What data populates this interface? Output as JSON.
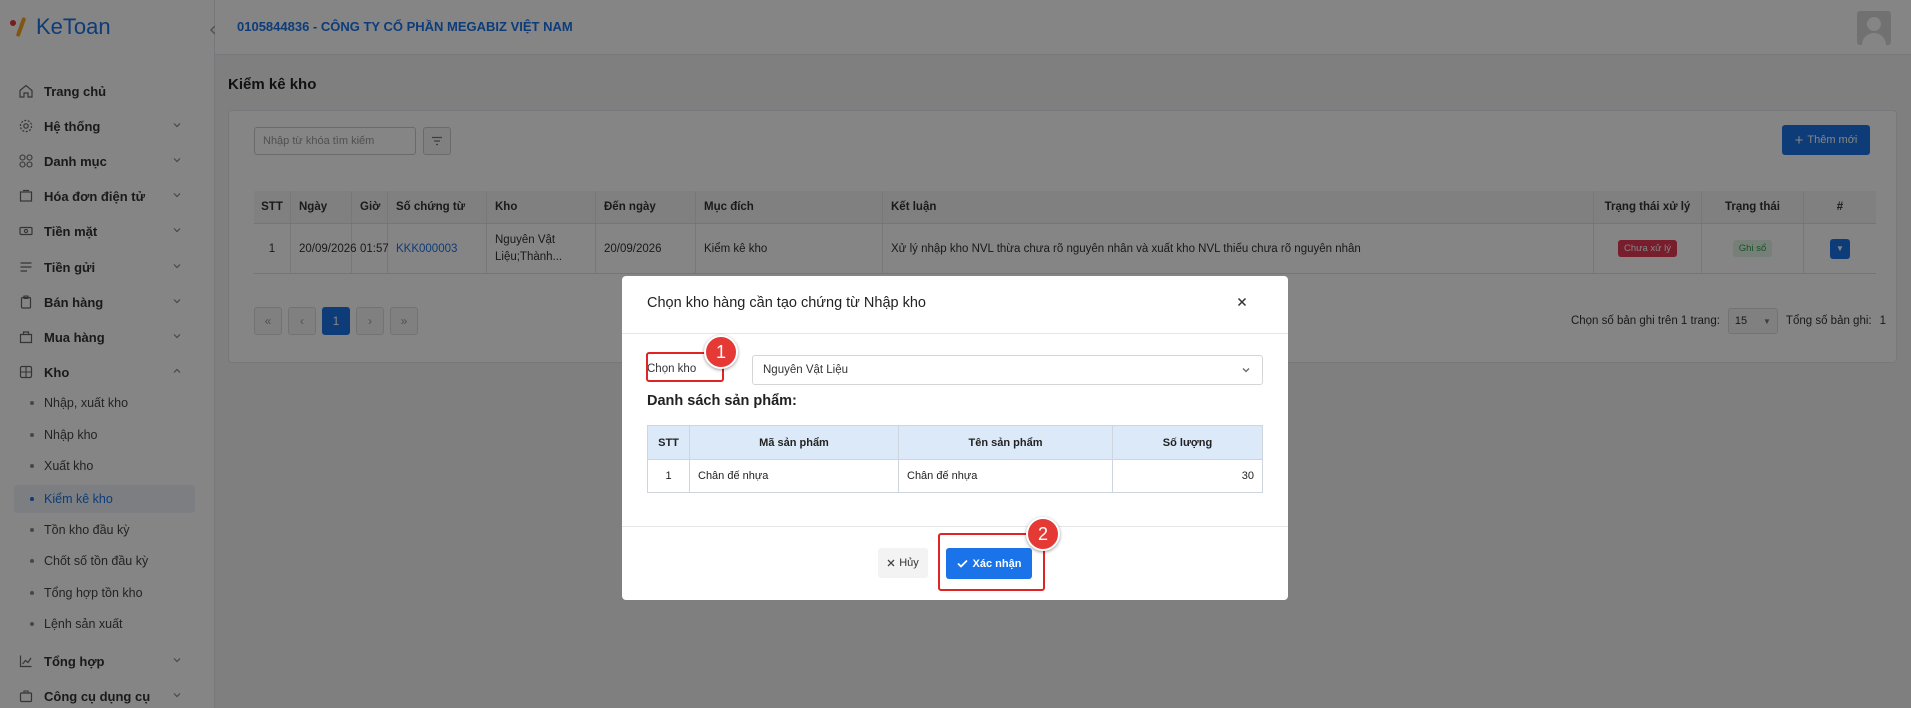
{
  "app": {
    "logo_text": "KeToan",
    "company": "0105844836 - CÔNG TY CỔ PHẦN MEGABIZ VIỆT NAM"
  },
  "sidebar": {
    "items": [
      {
        "label": "Trang chủ",
        "icon": "home-icon"
      },
      {
        "label": "Hệ thống",
        "icon": "settings-icon"
      },
      {
        "label": "Danh mục",
        "icon": "grid-icon"
      },
      {
        "label": "Hóa đơn điện tử",
        "icon": "invoice-icon"
      },
      {
        "label": "Tiền mặt",
        "icon": "cash-icon"
      },
      {
        "label": "Tiền gửi",
        "icon": "deposit-icon"
      },
      {
        "label": "Bán hàng",
        "icon": "sales-icon"
      },
      {
        "label": "Mua hàng",
        "icon": "purchase-icon"
      },
      {
        "label": "Kho",
        "icon": "warehouse-icon"
      },
      {
        "label": "Tổng hợp",
        "icon": "chart-icon"
      },
      {
        "label": "Công cụ dụng cụ",
        "icon": "tools-icon"
      }
    ],
    "sub_items": [
      {
        "label": "Nhập, xuất kho"
      },
      {
        "label": "Nhập kho"
      },
      {
        "label": "Xuất kho"
      },
      {
        "label": "Kiểm kê kho",
        "active": true
      },
      {
        "label": "Tồn kho đầu kỳ"
      },
      {
        "label": "Chốt số tồn đầu kỳ"
      },
      {
        "label": "Tổng hợp tồn kho"
      },
      {
        "label": "Lệnh sản xuất"
      }
    ]
  },
  "page": {
    "title": "Kiểm kê kho",
    "search_placeholder": "Nhập từ khóa tìm kiếm",
    "add_label": "Thêm mới"
  },
  "table": {
    "headers": [
      "STT",
      "Ngày",
      "Giờ",
      "Số chứng từ",
      "Kho",
      "Đến ngày",
      "Mục đích",
      "Kết luận",
      "Trạng thái xử lý",
      "Trạng thái",
      "#"
    ],
    "rows": [
      {
        "stt": "1",
        "ngay": "20/09/2026",
        "gio": "01:57",
        "so_ct": "KKK000003",
        "kho_line1": "Nguyên Vật",
        "kho_line2": "Liệu;Thành...",
        "den_ngay": "20/09/2026",
        "muc_dich": "Kiểm kê kho",
        "ket_luan": "Xử lý nhập kho NVL thừa chưa rõ nguyên nhân và xuất kho NVL thiếu chưa rõ nguyên nhân",
        "trang_thai_xl": "Chưa xử lý",
        "trang_thai": "Ghi sổ"
      }
    ]
  },
  "pagination": {
    "current": "1",
    "per_page_label": "Chọn số bản ghi trên 1 trang:",
    "per_page_value": "15",
    "total_label": "Tổng số bản ghi:",
    "total_value": "1"
  },
  "modal": {
    "title": "Chọn kho hàng cần tạo chứng từ Nhập kho",
    "kho_label": "Chọn kho",
    "kho_value": "Nguyên Vật Liệu",
    "list_title": "Danh sách sản phẩm:",
    "headers": [
      "STT",
      "Mã sản phẩm",
      "Tên sản phẩm",
      "Số lượng"
    ],
    "rows": [
      {
        "stt": "1",
        "ma": "Chân đế nhựa",
        "ten": "Chân đế nhựa",
        "so_luong": "30"
      }
    ],
    "cancel_label": "Hủy",
    "confirm_label": "Xác nhận"
  },
  "annotations": {
    "step1": "1",
    "step2": "2"
  },
  "colors": {
    "primary": "#1a73e8",
    "danger": "#e53955",
    "success": "#2e9c4e",
    "annotation": "#e53935"
  }
}
